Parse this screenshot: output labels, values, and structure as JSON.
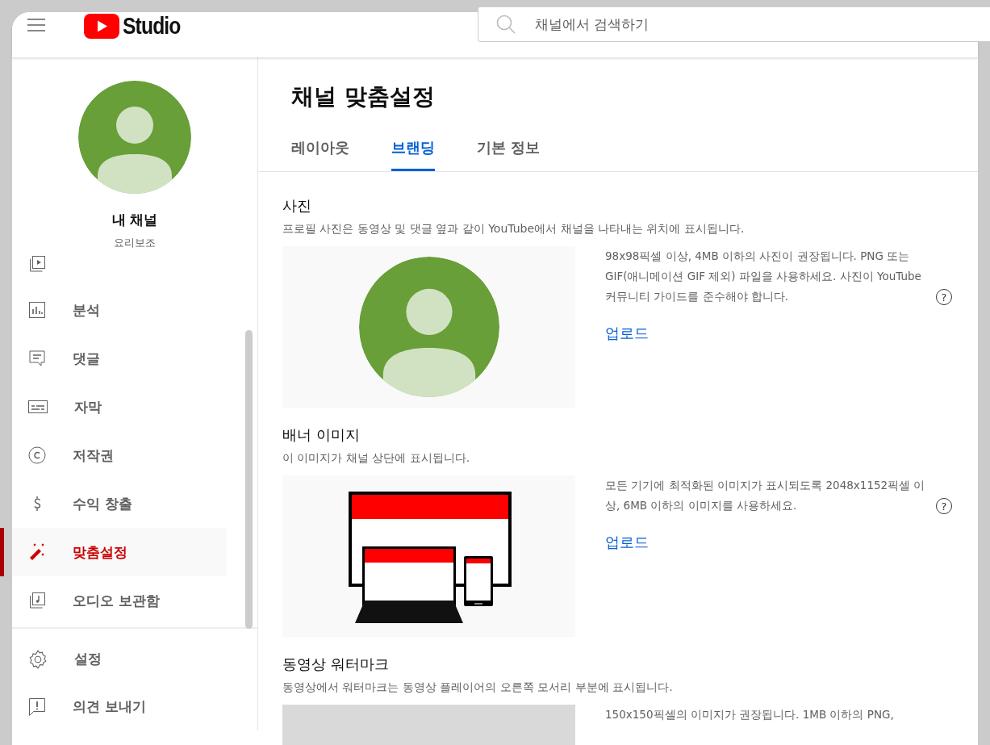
{
  "header": {
    "logo": "Studio",
    "search": {
      "placeholder": "채널에서 검색하기"
    }
  },
  "channel": {
    "name": "내 채널",
    "handle": "요리보조"
  },
  "nav": [
    {
      "label": "분석",
      "selected": false
    },
    {
      "label": "댓글",
      "selected": false
    },
    {
      "label": "자막",
      "selected": false
    },
    {
      "label": "저작권",
      "selected": false
    },
    {
      "label": "수익 창출",
      "selected": false
    },
    {
      "label": "맞춤설정",
      "selected": true
    },
    {
      "label": "오디오 보관함",
      "selected": false
    }
  ],
  "footer_nav": [
    {
      "label": "설정"
    },
    {
      "label": "의견 보내기"
    }
  ],
  "page": {
    "title": "채널 맞춤설정",
    "tabs": [
      {
        "label": "레이아웃",
        "selected": false
      },
      {
        "label": "브랜딩",
        "selected": true
      },
      {
        "label": "기본 정보",
        "selected": false
      }
    ],
    "sections": [
      {
        "kind": "avatar",
        "title": "사진",
        "description": "프로필 사진은 동영상 및 댓글 옆과 같이 YouTube에서 채널을 나타내는 위치에 표시됩니다.",
        "info": "98x98픽셀 이상, 4MB 이하의 사진이 권장됩니다. PNG 또는 GIF(애니메이션 GIF 제외) 파일을 사용하세요. 사진이 YouTube 커뮤니티 가이드를 준수해야 합니다.",
        "help": "?",
        "upload": "업로드"
      },
      {
        "kind": "devices",
        "title": "배너 이미지",
        "description": "이 이미지가 채널 상단에 표시됩니다.",
        "info": "모든 기기에 최적화된 이미지가 표시되도록 2048x1152픽셀 이상, 6MB 이하의 이미지를 사용하세요.",
        "help": "?",
        "upload": "업로드"
      },
      {
        "kind": "placeholder",
        "title": "동영상 워터마크",
        "description": "동영상에서 워터마크는 동영상 플레이어의 오른쪽 모서리 부분에 표시됩니다.",
        "info": "150x150픽셀의 이미지가 권장됩니다. 1MB 이하의 PNG,"
      }
    ]
  }
}
